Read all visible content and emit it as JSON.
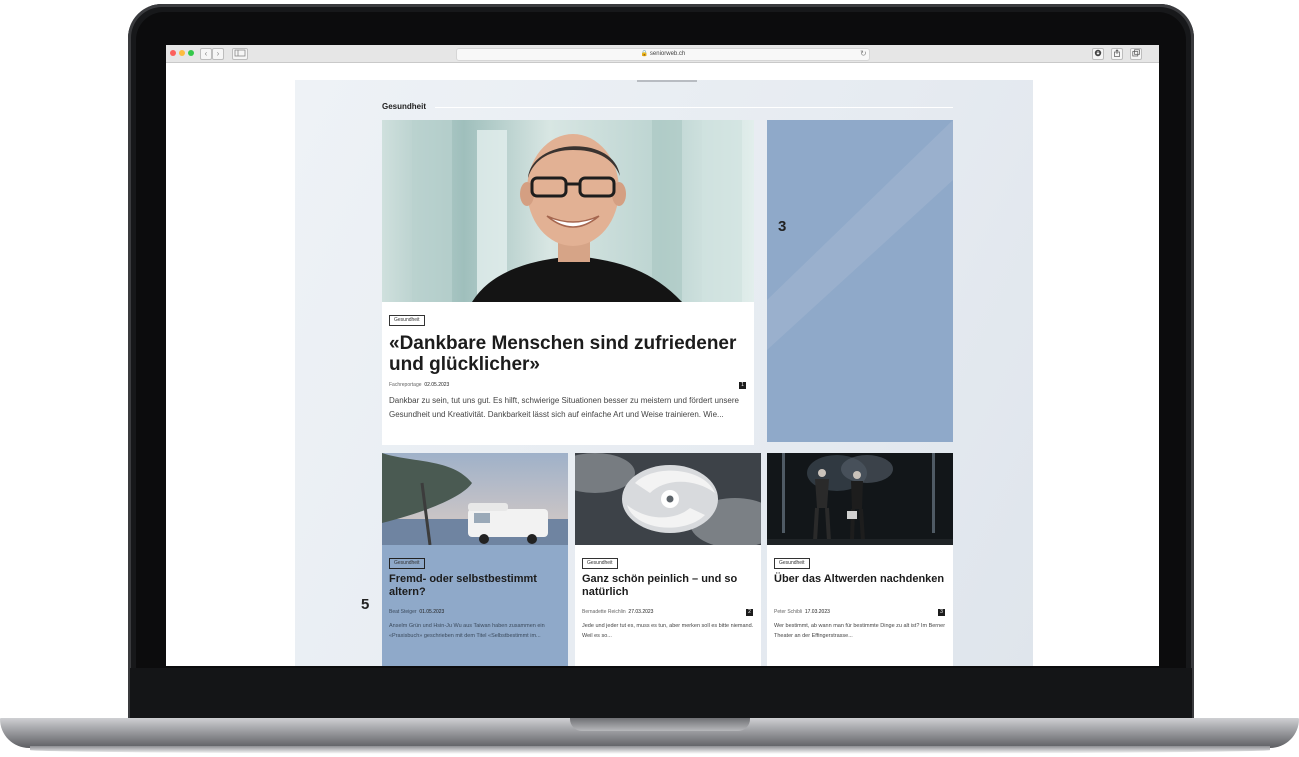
{
  "browser": {
    "url": "seniorweb.ch",
    "back_glyph": "‹",
    "forward_glyph": "›",
    "reload_glyph": "↻",
    "traffic_lights": [
      "#fc605c",
      "#fdbc40",
      "#34c84a"
    ]
  },
  "section": {
    "title": "Gesundheit"
  },
  "feature": {
    "tag": "Gesundheit",
    "title": "«Dankbare Menschen sind zufriedener und glücklicher»",
    "meta_type": "Fachreportage",
    "date": "02.05.2023",
    "comments": "1",
    "excerpt": "Dankbar zu sein, tut uns gut. Es hilft, schwierige Situationen besser zu meistern und fördert unsere Gesundheit und Kreativität. Dankbarkeit lässt sich auf einfache Art und Weise trainieren. Wie..."
  },
  "ad": {
    "number": "3",
    "color": "#8fa9c9"
  },
  "cards": [
    {
      "tag": "Gesundheit",
      "title": "Fremd- oder selbstbestimmt altern?",
      "author": "Beat Steiger",
      "date": "01.05.2023",
      "comments": "",
      "excerpt": "Anselm Grün und Hsin-Ju Wu aus Taiwan haben zusammen ein «Praxisbuch» geschrieben mit dem Titel «Selbstbestimmt im..."
    },
    {
      "tag": "Gesundheit",
      "title": "Ganz schön peinlich – und so natürlich",
      "author": "Bernadette Reichlin",
      "date": "27.03.2023",
      "comments": "2",
      "excerpt": "Jede und jeder tut es, muss es tun, aber merken soll es bitte niemand. Weil es so..."
    },
    {
      "tag": "Gesundheit",
      "title": "Über das Altwerden nachdenken",
      "author": "Peter Schibli",
      "date": "17.03.2023",
      "comments": "3",
      "excerpt": "Wer bestimmt, ab wann man für bestimmte Dinge zu alt ist? Im Berner Theater an der Effingerstrasse..."
    }
  ],
  "overlay_label": "5"
}
